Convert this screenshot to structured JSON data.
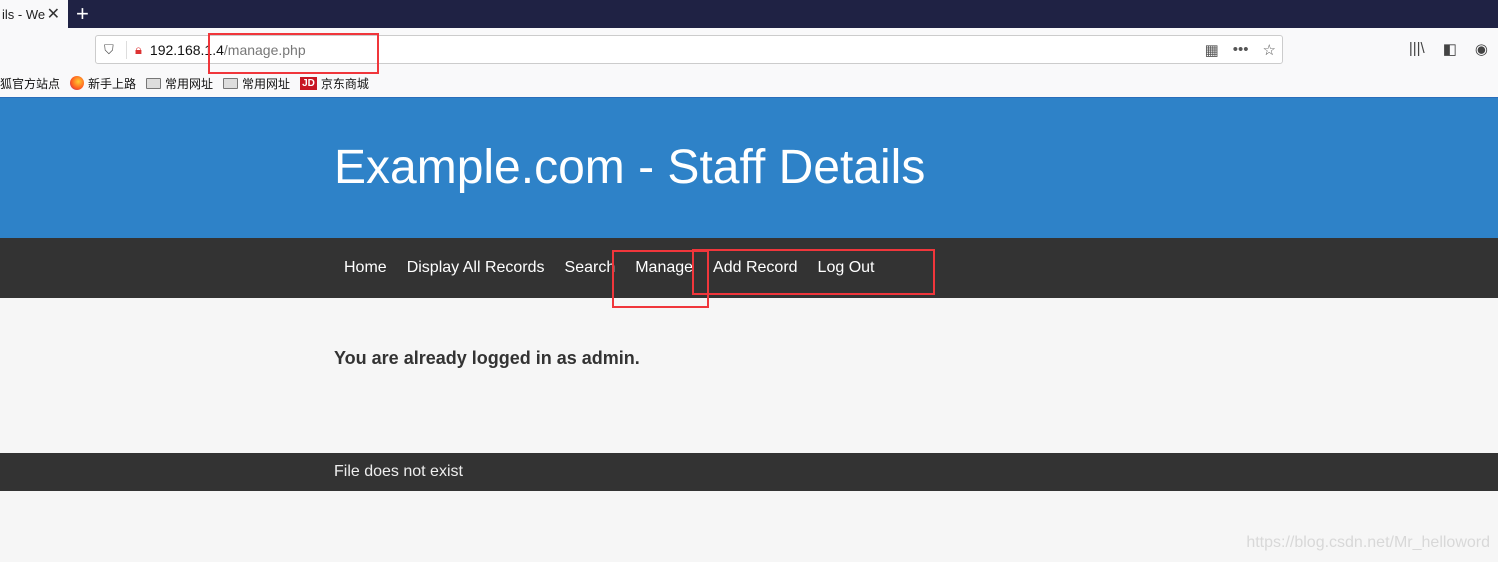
{
  "browser": {
    "tab_title": "ils - We",
    "new_tab": "+",
    "close": "✕",
    "url_host": "192.168.1.4",
    "url_path": "/manage.php",
    "bookmarks": [
      {
        "label": "狐官方站点",
        "icon": "none"
      },
      {
        "label": "新手上路",
        "icon": "firefox-icon"
      },
      {
        "label": "常用网址",
        "icon": "folder-icon"
      },
      {
        "label": "常用网址",
        "icon": "folder-icon"
      },
      {
        "label": "京东商城",
        "icon": "jd-icon"
      }
    ],
    "jd": "JD"
  },
  "page": {
    "title": "Example.com - Staff Details",
    "menu": [
      "Home",
      "Display All Records",
      "Search",
      "Manage",
      "Add Record",
      "Log Out"
    ],
    "message": "You are already logged in as admin.",
    "footer": "File does not exist"
  },
  "watermark": "https://blog.csdn.net/Mr_helloword",
  "colors": {
    "header": "#2e82c8",
    "menu": "#333333",
    "annotation": "#f0363b"
  }
}
